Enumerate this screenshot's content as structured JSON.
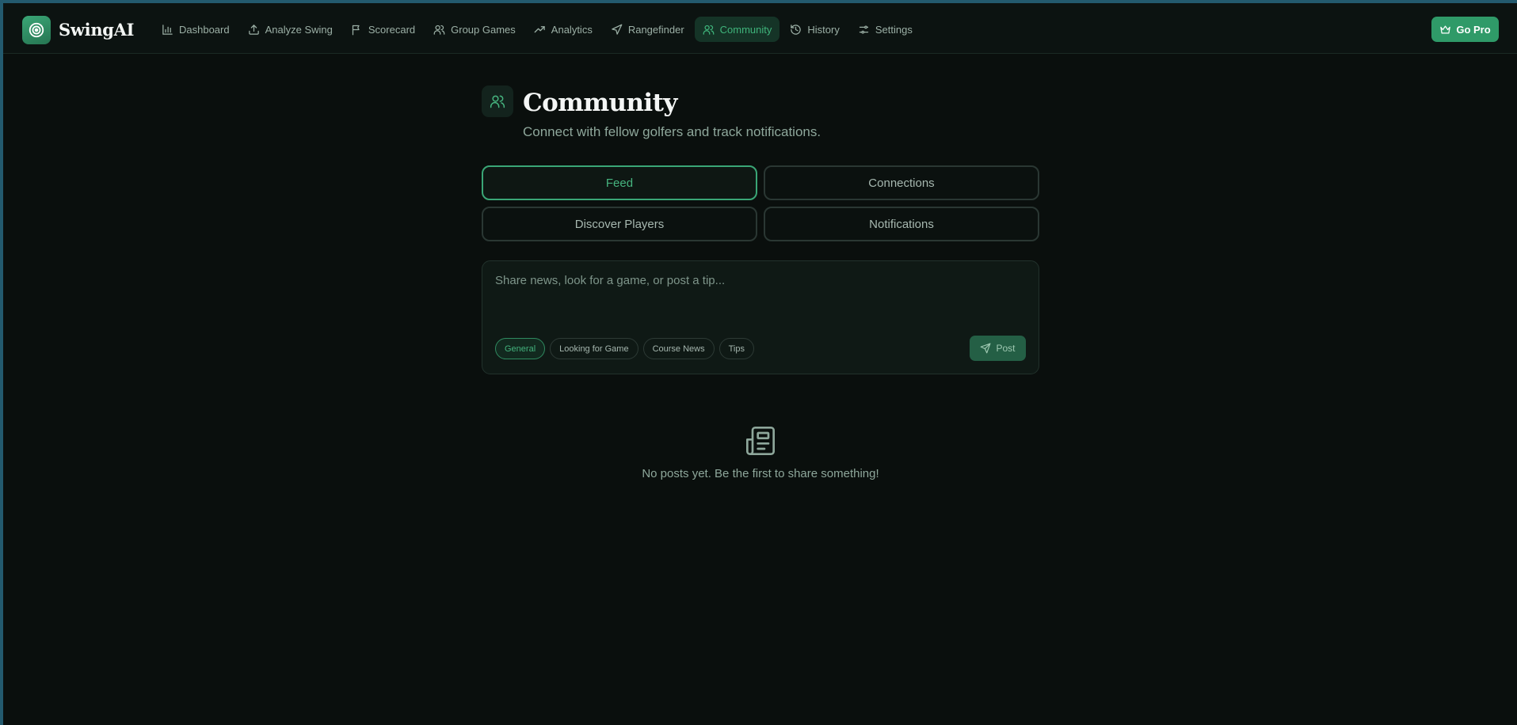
{
  "app": {
    "name": "SwingAI"
  },
  "nav": {
    "items": [
      {
        "label": "Dashboard",
        "icon": "bar-chart-icon"
      },
      {
        "label": "Analyze Swing",
        "icon": "upload-icon"
      },
      {
        "label": "Scorecard",
        "icon": "flag-icon"
      },
      {
        "label": "Group Games",
        "icon": "users-icon"
      },
      {
        "label": "Analytics",
        "icon": "trending-up-icon"
      },
      {
        "label": "Rangefinder",
        "icon": "navigation-icon"
      },
      {
        "label": "Community",
        "icon": "users-icon",
        "active": true
      },
      {
        "label": "History",
        "icon": "history-icon"
      },
      {
        "label": "Settings",
        "icon": "sliders-icon"
      }
    ],
    "go_pro_label": "Go Pro"
  },
  "header": {
    "title": "Community",
    "subtitle": "Connect with fellow golfers and track notifications."
  },
  "tabs": [
    {
      "label": "Feed",
      "active": true
    },
    {
      "label": "Connections"
    },
    {
      "label": "Discover Players"
    },
    {
      "label": "Notifications"
    }
  ],
  "composer": {
    "placeholder": "Share news, look for a game, or post a tip...",
    "value": "",
    "categories": [
      {
        "label": "General",
        "active": true
      },
      {
        "label": "Looking for Game"
      },
      {
        "label": "Course News"
      },
      {
        "label": "Tips"
      }
    ],
    "post_label": "Post"
  },
  "empty_state": {
    "icon": "newspaper-icon",
    "message": "No posts yet. Be the first to share something!"
  },
  "colors": {
    "accent": "#3aa676",
    "background": "#0a0f0d",
    "nav_active_bg": "#153427"
  }
}
